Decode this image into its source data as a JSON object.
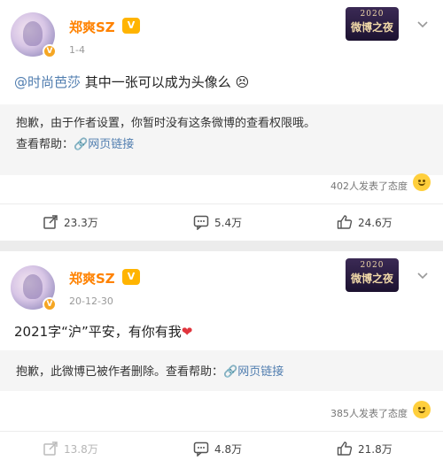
{
  "posts": [
    {
      "username": "郑爽SZ",
      "vip_label": "V",
      "verified_label": "V",
      "time": "1-4",
      "event_badge": {
        "year": "2020",
        "name": "微博之夜"
      },
      "text_mention": "@时尚芭莎",
      "text_body": " 其中一张可以成为头像么",
      "text_emoji": "😣",
      "notice": "抱歉，由于作者设置，你暂时没有这条微博的查看权限哦。",
      "help_prefix": "查看帮助：",
      "help_link": "🔗网页链接",
      "likers": "402人发表了态度",
      "actions": {
        "repost": "23.3万",
        "comment": "5.4万",
        "like": "24.6万"
      },
      "repost_disabled": false
    },
    {
      "username": "郑爽SZ",
      "vip_label": "V",
      "verified_label": "V",
      "time": "20-12-30",
      "event_badge": {
        "year": "2020",
        "name": "微博之夜"
      },
      "text_body": "2021字“沪”平安，有你有我",
      "text_heart": "❤",
      "notice_prefix": "抱歉，此微博已被作者删除。查看帮助：",
      "help_link": "🔗网页链接",
      "likers": "385人发表了态度",
      "actions": {
        "repost": "13.8万",
        "comment": "4.8万",
        "like": "21.8万"
      },
      "repost_disabled": true
    }
  ]
}
